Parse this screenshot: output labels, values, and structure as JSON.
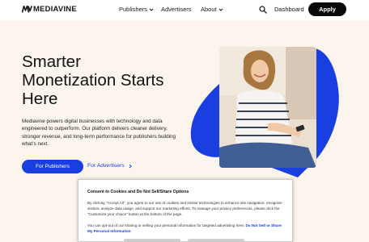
{
  "header": {
    "logo_text": "MEDIAVINE",
    "nav": [
      {
        "label": "Publishers",
        "has_dropdown": true
      },
      {
        "label": "Advertisers",
        "has_dropdown": false
      },
      {
        "label": "About",
        "has_dropdown": true
      }
    ],
    "dashboard_label": "Dashboard",
    "apply_label": "Apply",
    "search_icon": "search-icon"
  },
  "hero": {
    "headline_line1": "Smarter",
    "headline_line2": "Monetization Starts",
    "headline_line3": "Here",
    "subtext": "Mediavine powers digital businesses with technology and data engineered to outperform. Our platform delivers cleaner delivery, stronger revenue, and long-term performance for publishers building what’s next.",
    "primary_cta": "For Publishers",
    "secondary_cta": "For Advertisers"
  },
  "consent": {
    "title": "Consent to Cookies and Do Not Sell/Share Options",
    "body": "By clicking \"Accept All\", you agree to our use of cookies and similar technologies to enhance site navigation, recognize visitors, analyze data usage, and support our marketing efforts. To manage your privacy preferences, please click the \"Customize your choice\" button at the bottom of the page.",
    "optout_text": "You can opt-out of our sharing or selling your personal information for targeted advertising here: ",
    "optout_link": "Do Not Sell or Share My Personal Information"
  },
  "colors": {
    "brand_blue": "#1a3fe0",
    "background": "#fbf5ee",
    "apply_button": "#0a0a0a"
  }
}
